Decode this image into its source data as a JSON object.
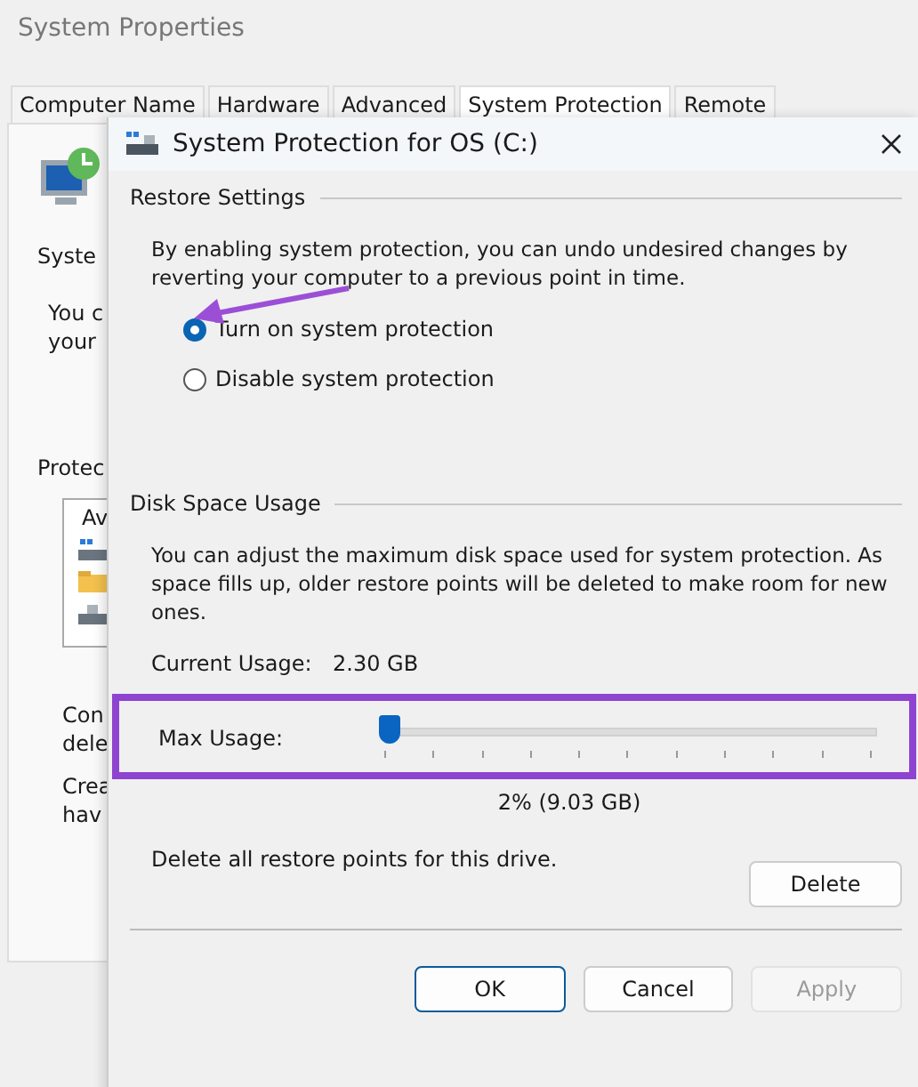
{
  "background_window": {
    "title": "System Properties",
    "tabs": [
      {
        "label": "Computer Name",
        "selected": false
      },
      {
        "label": "Hardware",
        "selected": false
      },
      {
        "label": "Advanced",
        "selected": false
      },
      {
        "label": "System Protection",
        "selected": true
      },
      {
        "label": "Remote",
        "selected": false
      }
    ],
    "fragments": [
      "Syste",
      "You c",
      "your",
      "Protec",
      "Av",
      "Con",
      "dele",
      "Crea",
      "hav"
    ]
  },
  "dialog": {
    "title": "System Protection for OS (C:)",
    "restore_settings": {
      "heading": "Restore Settings",
      "description": "By enabling system protection, you can undo undesired changes by reverting your computer to a previous point in time.",
      "options": [
        {
          "label": "Turn on system protection",
          "selected": true
        },
        {
          "label": "Disable system protection",
          "selected": false
        }
      ]
    },
    "disk_space": {
      "heading": "Disk Space Usage",
      "description": "You can adjust the maximum disk space used for system protection. As space fills up, older restore points will be deleted to make room for new ones.",
      "current_usage_label": "Current Usage:",
      "current_usage_value": "2.30 GB",
      "max_usage_label": "Max Usage:",
      "max_usage": {
        "level": 0.02
      },
      "max_usage_reading": "2% (9.03 GB)",
      "delete_text": "Delete all restore points for this drive.",
      "delete_button": "Delete"
    },
    "buttons": [
      {
        "label": "OK",
        "disabled": false,
        "default": true
      },
      {
        "label": "Cancel",
        "disabled": false,
        "default": false
      },
      {
        "label": "Apply",
        "disabled": true,
        "default": false
      }
    ]
  }
}
